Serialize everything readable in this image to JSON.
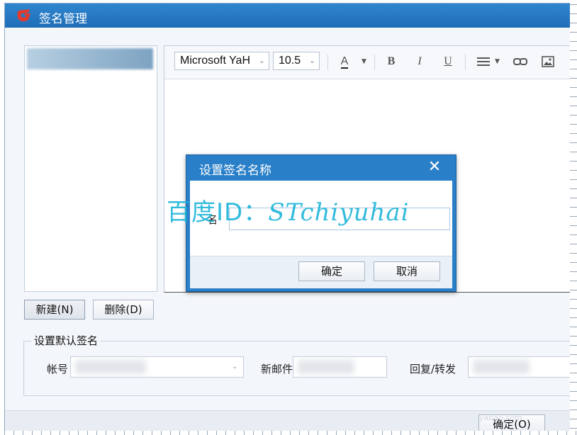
{
  "window": {
    "title": "签名管理"
  },
  "toolbar": {
    "font_family": "Microsoft YaH",
    "font_size": "10.5",
    "color_letter": "A",
    "bold": "B",
    "italic": "I",
    "underline": "U"
  },
  "list_buttons": {
    "new": "新建(N)",
    "delete": "删除(D)"
  },
  "default_signature": {
    "group_label": "设置默认签名",
    "account_label": "帐号",
    "new_mail_label": "新邮件",
    "reply_forward_label": "回复/转发"
  },
  "footer": {
    "ok": "确定(O)"
  },
  "dialog": {
    "title": "设置签名名称",
    "name_label": "名",
    "name_value": "",
    "ok": "确定",
    "cancel": "取消"
  },
  "watermark": {
    "prefix": "百度ID：",
    "handle": "STchiyuhai"
  },
  "site_mark": "yabao.com",
  "colors": {
    "titlebar": "#1e6db7",
    "dialog_frame": "#2a7fc9",
    "watermark": "#18b2d8"
  }
}
